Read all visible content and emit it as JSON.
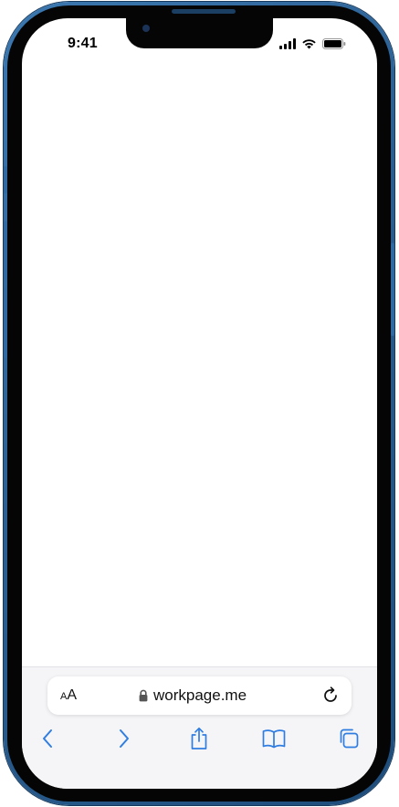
{
  "status_bar": {
    "time": "9:41"
  },
  "address_bar": {
    "text_size_label_small": "A",
    "text_size_label_large": "A",
    "url": "workpage.me"
  },
  "toolbar": {
    "icons": [
      "back-icon",
      "forward-icon",
      "share-icon",
      "bookmarks-icon",
      "tabs-icon"
    ]
  },
  "colors": {
    "device_frame": "#2b5f92",
    "accent": "#2f7de1",
    "bar_background": "#f5f5f7"
  }
}
